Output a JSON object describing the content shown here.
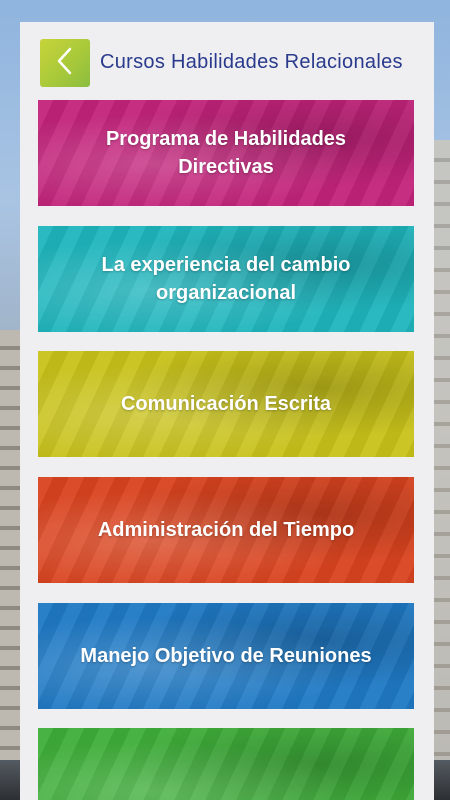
{
  "header": {
    "title": "Cursos Habilidades Relacionales",
    "back_icon": "chevron-left-icon"
  },
  "courses": [
    {
      "label": "Programa de Habilidades Directivas",
      "color": "#c2237a"
    },
    {
      "label": "La experiencia del cambio organizacional",
      "color": "#1fb5bd"
    },
    {
      "label": "Comunicación Escrita",
      "color": "#c8c21a"
    },
    {
      "label": "Administración del Tiempo",
      "color": "#d9431f"
    },
    {
      "label": "Manejo Objetivo de Reuniones",
      "color": "#1f79c4"
    },
    {
      "label": "",
      "color": "#3fae3a"
    }
  ],
  "colors": {
    "title_text": "#2a3a8c",
    "back_button": "#a9c93a",
    "panel_bg": "#efeff1"
  }
}
